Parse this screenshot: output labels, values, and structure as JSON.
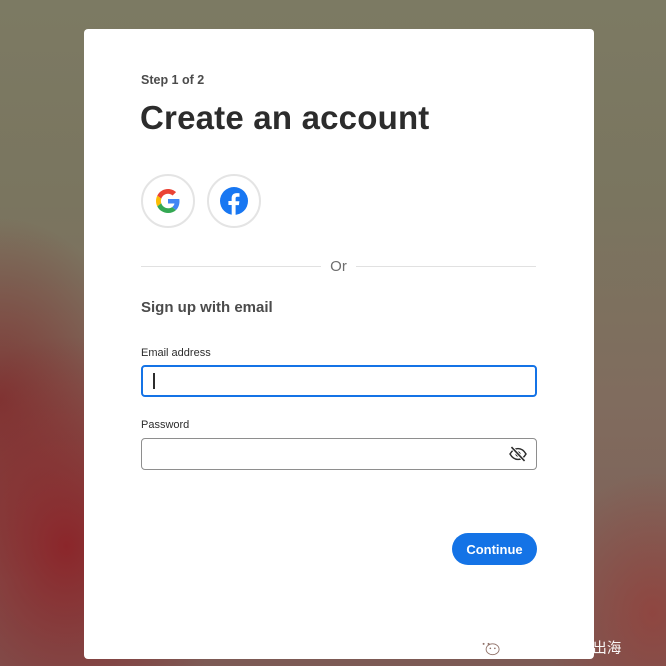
{
  "card": {
    "step": "Step 1 of 2",
    "title": "Create an account",
    "divider_text": "Or",
    "signup_heading": "Sign up with email"
  },
  "social_buttons": [
    {
      "provider": "google",
      "icon": "google-logo-icon"
    },
    {
      "provider": "facebook",
      "icon": "facebook-logo-icon"
    }
  ],
  "form": {
    "email_label": "Email address",
    "email_value": "",
    "password_label": "Password",
    "password_value": "",
    "password_toggle_icon": "eye-slash-icon",
    "continue_label": "Continue"
  },
  "watermark": {
    "text": "公众号 · 猎者出海",
    "icon": "wechat-logo-icon"
  },
  "colors": {
    "accent": "#1473e6",
    "google_blue": "#4285F4",
    "google_red": "#EA4335",
    "google_yellow": "#FBBC05",
    "google_green": "#34A853",
    "facebook_blue": "#1877F2"
  }
}
